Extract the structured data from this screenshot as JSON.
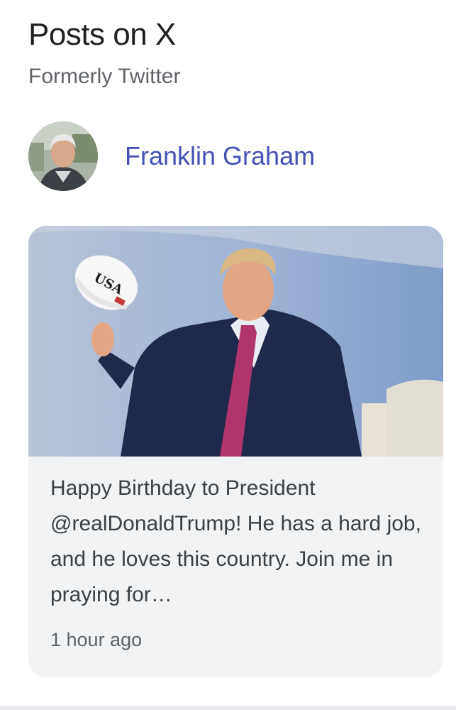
{
  "section": {
    "title": "Posts on X",
    "subtitle": "Formerly Twitter"
  },
  "author": {
    "name": "Franklin Graham",
    "avatar_icon": "profile-photo"
  },
  "post": {
    "image_alt": "photo-of-man-holding-white-cap",
    "cap_text": "USA",
    "text": "Happy Birthday to President @realDonaldTrump! He has a hard job, and he loves this country. Join me in praying for…",
    "time": "1 hour ago"
  },
  "colors": {
    "title": "#202124",
    "subtitle": "#5f6368",
    "author_link": "#4450b5",
    "card_bg": "#f1f3f4"
  }
}
